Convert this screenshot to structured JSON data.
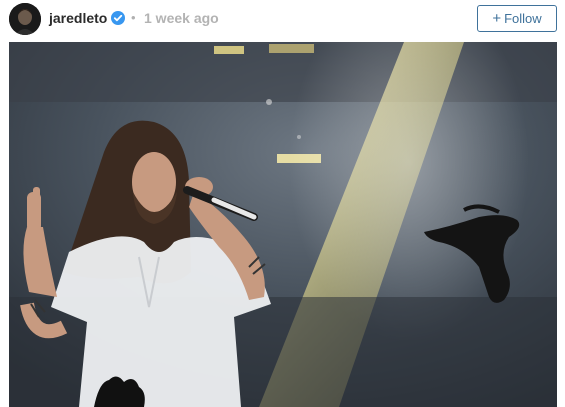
{
  "post": {
    "username": "jaredleto",
    "verified": true,
    "separator": "•",
    "timestamp": "1 week ago",
    "follow_button": {
      "icon": "plus-icon",
      "label": "Follow"
    },
    "photo": {
      "subject": "concert-photo"
    }
  },
  "colors": {
    "accent": "#3f729b",
    "verified_badge": "#3897f0",
    "muted_text": "#b3b3b3"
  }
}
